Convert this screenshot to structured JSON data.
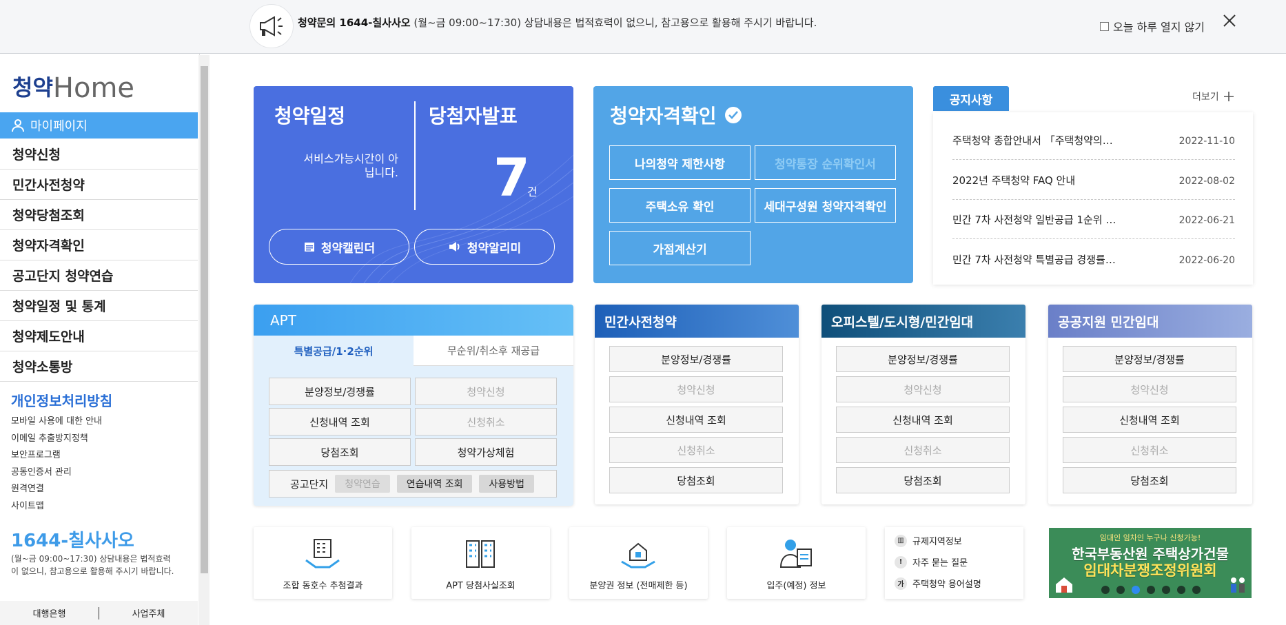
{
  "topbar": {
    "notice_bold": "청약문의 1644-칠사사오",
    "notice_rest": " (월~금 09:00~17:30) 상담내용은 법적효력이 없으니, 참고용으로 활용해 주시기 바랍니다.",
    "dont_show": "오늘 하루 열지 않기"
  },
  "sidebar": {
    "logo_a": "청약",
    "logo_b": "Home",
    "mypage": "마이페이지",
    "items": [
      "청약신청",
      "민간사전청약",
      "청약당첨조회",
      "청약자격확인",
      "공고단지 청약연습",
      "청약일정 및 통계",
      "청약제도안내",
      "청약소통방"
    ],
    "privacy": "개인정보처리방침",
    "sublinks": [
      "모바일 사용에 대한 안내",
      "이메일 추출방지정책",
      "보안프로그램",
      "공동인증서 관리",
      "원격연결",
      "사이트맵"
    ],
    "cc_number": "1644-칠사사오",
    "cc_desc": "(월~금 09:00~17:30) 상담내용은 법적효력이 없으니, 참고용으로 활용해 주시기 바랍니다.",
    "bottom": [
      "대행은행",
      "사업주체"
    ]
  },
  "schedule_card": {
    "title": "청약일정",
    "winners_title": "당첨자발표",
    "service_msg": "서비스가능시간이 아닙니다.",
    "count": "7",
    "count_unit": "건",
    "calendar_btn": "청약캘린더",
    "alert_btn": "청약알리미"
  },
  "eligibility_card": {
    "title": "청약자격확인",
    "buttons": [
      "나의청약 제한사항",
      "청약통장 순위확인서",
      "주택소유 확인",
      "세대구성원 청약자격확인",
      "가점계산기"
    ]
  },
  "notices": {
    "tab": "공지사항",
    "more": "더보기",
    "items": [
      {
        "title": "주택청약 종합안내서 「주택청약의…",
        "date": "2022-11-10"
      },
      {
        "title": "2022년 주택청약 FAQ 안내",
        "date": "2022-08-02"
      },
      {
        "title": "민간 7차 사전청약 일반공급 1순위 …",
        "date": "2022-06-21"
      },
      {
        "title": "민간 7차 사전청약 특별공급 경쟁률…",
        "date": "2022-06-20"
      }
    ]
  },
  "apt": {
    "title": "APT",
    "tab_on": "특별공급/1·2순위",
    "tab_off": "무순위/취소후 재공급",
    "buttons": [
      "분양정보/경쟁률",
      "청약신청",
      "신청내역 조회",
      "신청취소",
      "당첨조회",
      "청약가상체험"
    ],
    "practice_label": "공고단지",
    "chips": [
      "청약연습",
      "연습내역 조회",
      "사용방법"
    ]
  },
  "categories": [
    {
      "title": "민간사전청약",
      "buttons": [
        "분양정보/경쟁률",
        "청약신청",
        "신청내역 조회",
        "신청취소",
        "당첨조회"
      ]
    },
    {
      "title": "오피스텔/도시형/민간임대",
      "buttons": [
        "분양정보/경쟁률",
        "청약신청",
        "신청내역 조회",
        "신청취소",
        "당첨조회"
      ]
    },
    {
      "title": "공공지원 민간임대",
      "buttons": [
        "분양정보/경쟁률",
        "청약신청",
        "신청내역 조회",
        "신청취소",
        "당첨조회"
      ]
    }
  ],
  "quick": [
    "조합 동호수 추첨결과",
    "APT 당첨사실조회",
    "분양권 정보 (전매제한 등)",
    "입주(예정) 정보"
  ],
  "links": [
    {
      "icon": "building-icon",
      "glyph": "▥",
      "label": "규제지역정보"
    },
    {
      "icon": "exclamation-icon",
      "glyph": "!",
      "label": "자주 묻는 질문"
    },
    {
      "icon": "ga-icon",
      "glyph": "가",
      "label": "주택청약 용어설명"
    }
  ],
  "banner": {
    "small": "임대인 임차인 누구나 신청가능!",
    "line1": "한국부동산원 주택상가건물",
    "line2": "임대차분쟁조정위원회",
    "active_slide": 3,
    "slide_count": 7
  },
  "colors": {
    "primary_blue": "#4a6fe0",
    "sky_blue": "#52a5e7",
    "accent": "#4aa5f0",
    "banner_green": "#3b8c58"
  }
}
